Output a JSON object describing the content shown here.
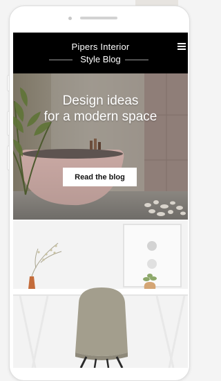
{
  "header": {
    "brand_line1": "Pipers Interior",
    "brand_line2": "Style Blog"
  },
  "hero": {
    "title_line1": "Design ideas",
    "title_line2": "for a modern space",
    "cta_label": "Read the blog"
  },
  "icons": {
    "menu": "hamburger-menu-icon"
  },
  "colors": {
    "header_bg": "#000000",
    "header_text": "#ffffff",
    "cta_bg": "#ffffff"
  }
}
